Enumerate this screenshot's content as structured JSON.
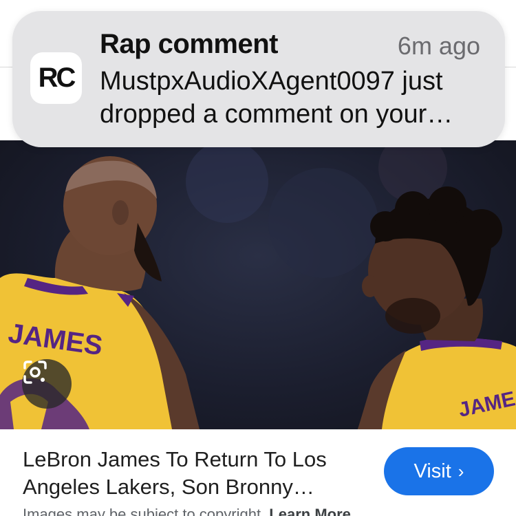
{
  "notification": {
    "app_icon_text": "RC",
    "title": "Rap comment",
    "time": "6m ago",
    "body": "MustpxAudioXAgent0097 just dropped a comment on your…"
  },
  "photo": {
    "jersey_left": "JAMES",
    "jersey_right": "JAME"
  },
  "result": {
    "caption": "LeBron James To Return To Los Angeles Lakers, Son Bronny…",
    "visit_label": "Visit",
    "visit_chevron": "›",
    "copyright_text": "Images may be subject to copyright.",
    "learn_more": "Learn More"
  },
  "colors": {
    "accent": "#1a73e8",
    "jersey_gold": "#f4c430",
    "jersey_purple": "#552583"
  },
  "icons": [
    "lens-icon",
    "chevron-right-icon"
  ]
}
